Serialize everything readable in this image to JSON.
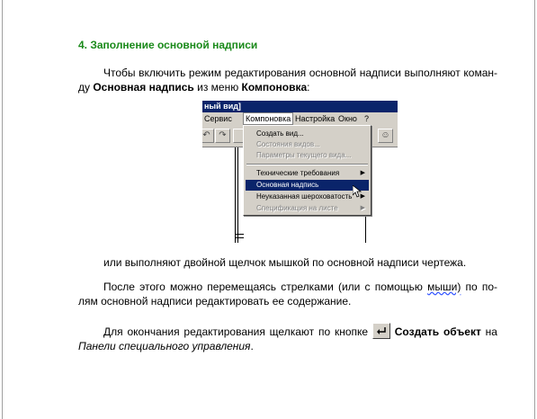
{
  "heading": "4. Заполнение основной надписи",
  "p1": {
    "t1": "Чтобы включить режим редактирования основной надписи выполняют коман-ду ",
    "b1": "Основная надпись",
    "t2": " из меню ",
    "b2": "Компоновка",
    "t3": ":"
  },
  "figure": {
    "title": "ный вид]",
    "menu": [
      "Сервис",
      "Компоновка",
      "Настройка",
      "Окно",
      "?"
    ],
    "dropdown": [
      {
        "label": "Создать вид...",
        "state": "enabled"
      },
      {
        "label": "Состояния видов...",
        "state": "disabled"
      },
      {
        "label": "Параметры текущего вида...",
        "state": "disabled"
      },
      {
        "label": "Технические требования",
        "state": "enabled",
        "submenu": true
      },
      {
        "label": "Основная надпись",
        "state": "selected"
      },
      {
        "label": "Неуказанная шероховатость",
        "state": "enabled",
        "submenu": true
      },
      {
        "label": "Спецификация на листе",
        "state": "disabled",
        "submenu": true
      }
    ]
  },
  "p2": "или выполняют двойной щелчок мышкой по основной надписи чертежа.",
  "p3": {
    "t1": "После этого можно перемещаясь стрелками (или с помощью ",
    "w": "мыши)",
    "t2": " по по-лям основной надписи редактировать ее содержание."
  },
  "p4": {
    "t1": "Для окончания редактирования щелкают по кнопке ",
    "b1": "Создать объект",
    "t2": " на ",
    "i1": "Панели специального управления",
    "t3": "."
  },
  "colors": {
    "heading": "#1a8a1a",
    "menu_highlight": "#0a246a"
  },
  "icons": [
    "enter-key-icon",
    "submenu-arrow-icon",
    "mouse-cursor-icon",
    "undo-icon",
    "redo-icon",
    "help-icon"
  ]
}
